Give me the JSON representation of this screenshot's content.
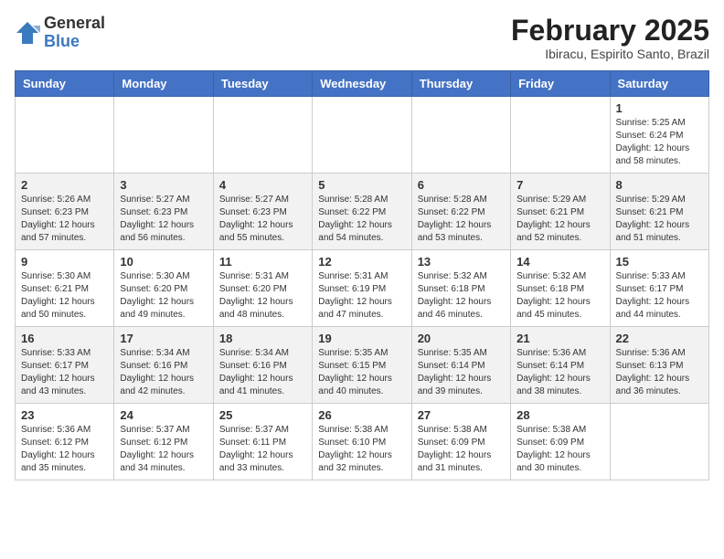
{
  "logo": {
    "general": "General",
    "blue": "Blue"
  },
  "title": "February 2025",
  "location": "Ibiracu, Espirito Santo, Brazil",
  "headers": [
    "Sunday",
    "Monday",
    "Tuesday",
    "Wednesday",
    "Thursday",
    "Friday",
    "Saturday"
  ],
  "weeks": [
    [
      {
        "day": "",
        "info": ""
      },
      {
        "day": "",
        "info": ""
      },
      {
        "day": "",
        "info": ""
      },
      {
        "day": "",
        "info": ""
      },
      {
        "day": "",
        "info": ""
      },
      {
        "day": "",
        "info": ""
      },
      {
        "day": "1",
        "info": "Sunrise: 5:25 AM\nSunset: 6:24 PM\nDaylight: 12 hours and 58 minutes."
      }
    ],
    [
      {
        "day": "2",
        "info": "Sunrise: 5:26 AM\nSunset: 6:23 PM\nDaylight: 12 hours and 57 minutes."
      },
      {
        "day": "3",
        "info": "Sunrise: 5:27 AM\nSunset: 6:23 PM\nDaylight: 12 hours and 56 minutes."
      },
      {
        "day": "4",
        "info": "Sunrise: 5:27 AM\nSunset: 6:23 PM\nDaylight: 12 hours and 55 minutes."
      },
      {
        "day": "5",
        "info": "Sunrise: 5:28 AM\nSunset: 6:22 PM\nDaylight: 12 hours and 54 minutes."
      },
      {
        "day": "6",
        "info": "Sunrise: 5:28 AM\nSunset: 6:22 PM\nDaylight: 12 hours and 53 minutes."
      },
      {
        "day": "7",
        "info": "Sunrise: 5:29 AM\nSunset: 6:21 PM\nDaylight: 12 hours and 52 minutes."
      },
      {
        "day": "8",
        "info": "Sunrise: 5:29 AM\nSunset: 6:21 PM\nDaylight: 12 hours and 51 minutes."
      }
    ],
    [
      {
        "day": "9",
        "info": "Sunrise: 5:30 AM\nSunset: 6:21 PM\nDaylight: 12 hours and 50 minutes."
      },
      {
        "day": "10",
        "info": "Sunrise: 5:30 AM\nSunset: 6:20 PM\nDaylight: 12 hours and 49 minutes."
      },
      {
        "day": "11",
        "info": "Sunrise: 5:31 AM\nSunset: 6:20 PM\nDaylight: 12 hours and 48 minutes."
      },
      {
        "day": "12",
        "info": "Sunrise: 5:31 AM\nSunset: 6:19 PM\nDaylight: 12 hours and 47 minutes."
      },
      {
        "day": "13",
        "info": "Sunrise: 5:32 AM\nSunset: 6:18 PM\nDaylight: 12 hours and 46 minutes."
      },
      {
        "day": "14",
        "info": "Sunrise: 5:32 AM\nSunset: 6:18 PM\nDaylight: 12 hours and 45 minutes."
      },
      {
        "day": "15",
        "info": "Sunrise: 5:33 AM\nSunset: 6:17 PM\nDaylight: 12 hours and 44 minutes."
      }
    ],
    [
      {
        "day": "16",
        "info": "Sunrise: 5:33 AM\nSunset: 6:17 PM\nDaylight: 12 hours and 43 minutes."
      },
      {
        "day": "17",
        "info": "Sunrise: 5:34 AM\nSunset: 6:16 PM\nDaylight: 12 hours and 42 minutes."
      },
      {
        "day": "18",
        "info": "Sunrise: 5:34 AM\nSunset: 6:16 PM\nDaylight: 12 hours and 41 minutes."
      },
      {
        "day": "19",
        "info": "Sunrise: 5:35 AM\nSunset: 6:15 PM\nDaylight: 12 hours and 40 minutes."
      },
      {
        "day": "20",
        "info": "Sunrise: 5:35 AM\nSunset: 6:14 PM\nDaylight: 12 hours and 39 minutes."
      },
      {
        "day": "21",
        "info": "Sunrise: 5:36 AM\nSunset: 6:14 PM\nDaylight: 12 hours and 38 minutes."
      },
      {
        "day": "22",
        "info": "Sunrise: 5:36 AM\nSunset: 6:13 PM\nDaylight: 12 hours and 36 minutes."
      }
    ],
    [
      {
        "day": "23",
        "info": "Sunrise: 5:36 AM\nSunset: 6:12 PM\nDaylight: 12 hours and 35 minutes."
      },
      {
        "day": "24",
        "info": "Sunrise: 5:37 AM\nSunset: 6:12 PM\nDaylight: 12 hours and 34 minutes."
      },
      {
        "day": "25",
        "info": "Sunrise: 5:37 AM\nSunset: 6:11 PM\nDaylight: 12 hours and 33 minutes."
      },
      {
        "day": "26",
        "info": "Sunrise: 5:38 AM\nSunset: 6:10 PM\nDaylight: 12 hours and 32 minutes."
      },
      {
        "day": "27",
        "info": "Sunrise: 5:38 AM\nSunset: 6:09 PM\nDaylight: 12 hours and 31 minutes."
      },
      {
        "day": "28",
        "info": "Sunrise: 5:38 AM\nSunset: 6:09 PM\nDaylight: 12 hours and 30 minutes."
      },
      {
        "day": "",
        "info": ""
      }
    ]
  ]
}
